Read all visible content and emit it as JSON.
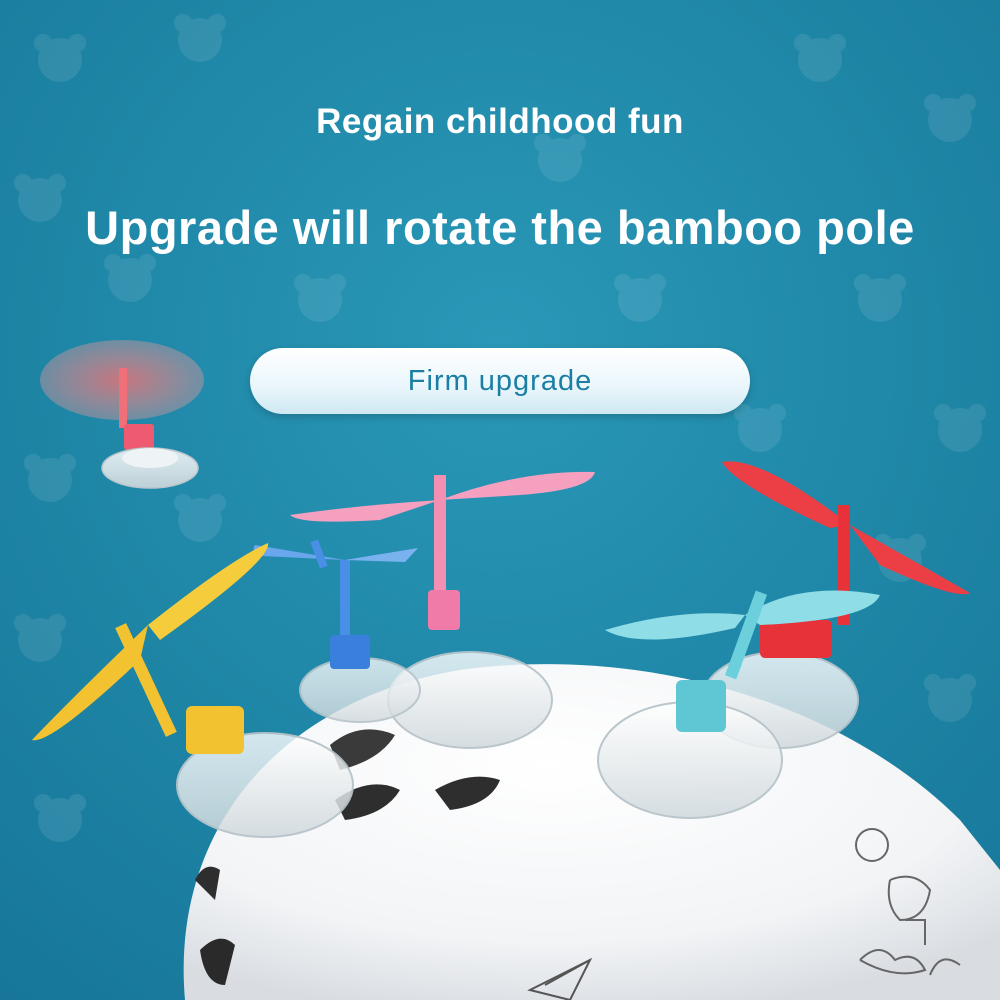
{
  "banner": {
    "tagline": "Regain childhood fun",
    "headline": "Upgrade will rotate the bamboo pole",
    "feature_pill": "Firm upgrade"
  },
  "colors": {
    "background": "#1f86a6",
    "text": "#ffffff",
    "pill_text": "#1b7fa4",
    "propeller_red": "#e8323a",
    "propeller_pink": "#f48fb4",
    "propeller_blue": "#4a8fe6",
    "propeller_yellow": "#f2c230",
    "propeller_cyan": "#6cd0dc"
  },
  "icons": [
    "bamboo-copter-icon",
    "bear-pattern-icon",
    "paper-plane-icon",
    "cloud-doodle-icon"
  ]
}
